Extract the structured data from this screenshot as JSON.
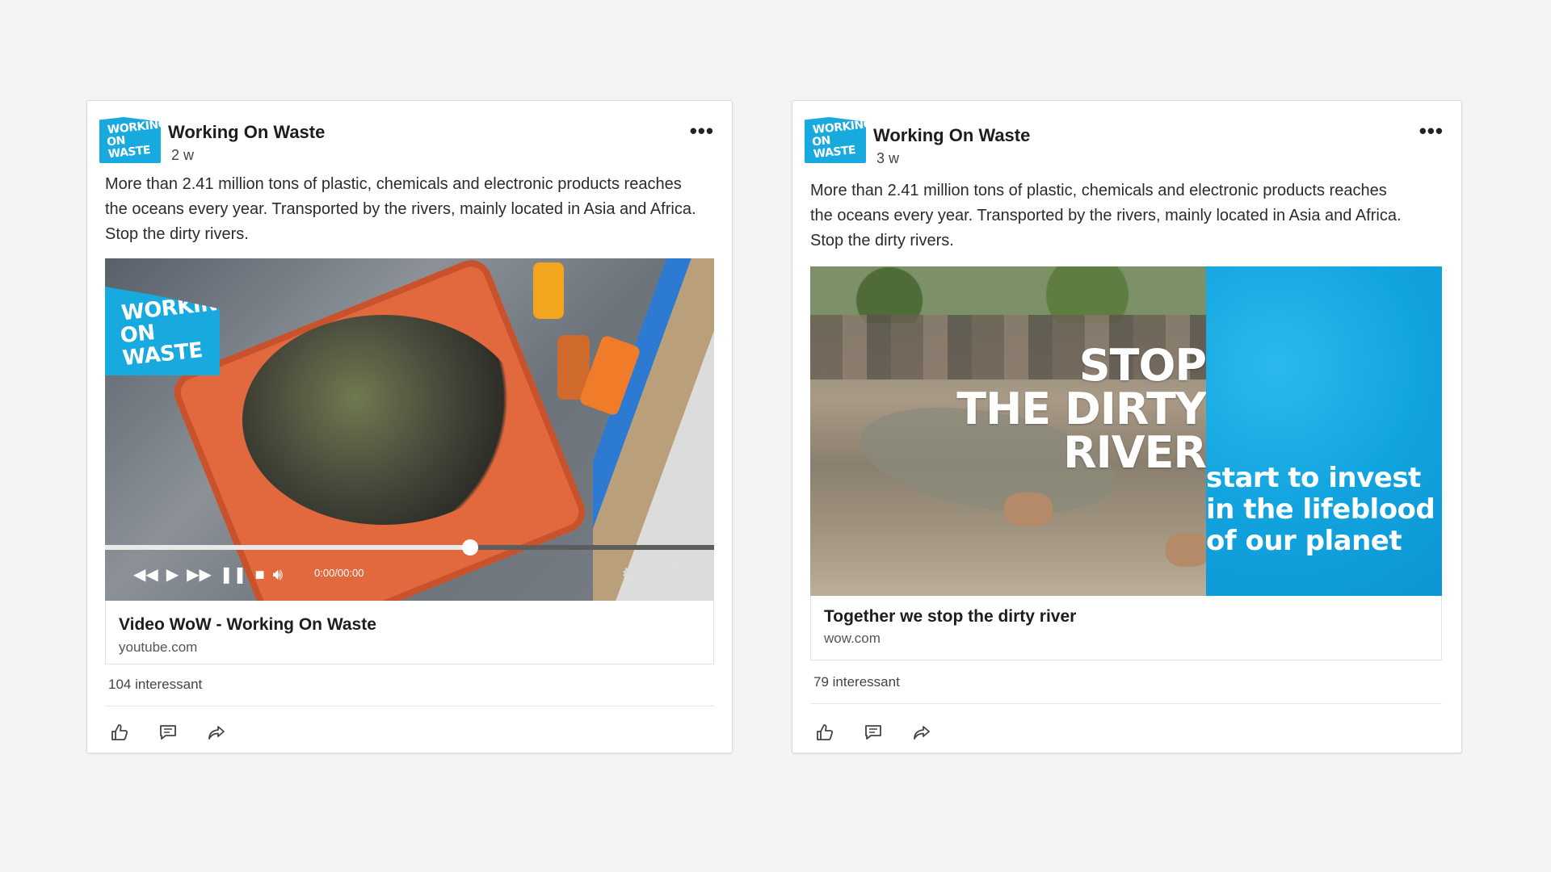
{
  "posts": [
    {
      "author": "Working On Waste",
      "age": "2 w",
      "logo_text": [
        "WORKING",
        "ON WASTE"
      ],
      "text": "More than 2.41 million tons of plastic, chemicals and electronic products reaches the oceans every year. Transported by the rivers, mainly located in Asia and Africa. Stop the dirty rivers.",
      "media": {
        "type": "video",
        "overlay_logo_text": [
          "WORKING",
          "ON WASTE"
        ],
        "time": "0:00/00:00",
        "progress": 0.6,
        "controls": [
          "rewind-icon",
          "play-icon",
          "fast-forward-icon",
          "pause-icon",
          "stop-icon",
          "volume-icon",
          "settings-icon",
          "fullscreen-icon"
        ]
      },
      "link_title": "Video WoW - Working On Waste",
      "link_url": "youtube.com",
      "reactions": "104 interessant"
    },
    {
      "author": "Working On Waste",
      "age": "3 w",
      "logo_text": [
        "WORKING",
        "ON WASTE"
      ],
      "text": "More than 2.41 million tons of plastic, chemicals and electronic products reaches the oceans every year. Transported by the rivers, mainly located in Asia and Africa. Stop the dirty rivers.",
      "media": {
        "type": "image",
        "headline": [
          "STOP",
          "THE DIRTY",
          "RIVER"
        ],
        "tagline": [
          "start to invest",
          "in the lifeblood",
          "of our planet"
        ]
      },
      "link_title": "Together we stop the dirty river",
      "link_url": "wow.com",
      "reactions": "79 interessant"
    }
  ],
  "actions": [
    "like-icon",
    "comment-icon",
    "share-icon"
  ],
  "colors": {
    "brand_blue": "#18a9df",
    "background": "#f3f4f6",
    "card": "#ffffff"
  }
}
